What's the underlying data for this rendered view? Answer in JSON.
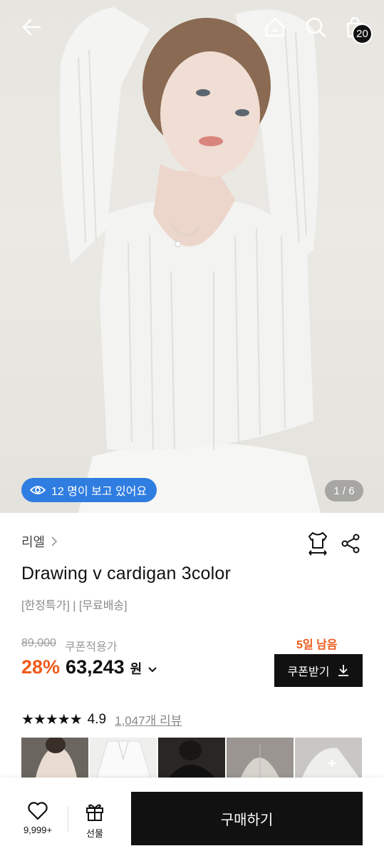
{
  "header": {
    "cart_count": "20",
    "icons": [
      "back-arrow-icon",
      "home-icon",
      "search-icon",
      "shopping-bag-icon"
    ]
  },
  "hero": {
    "viewers_text": "12 명이 보고 있어요",
    "pager": "1 / 6"
  },
  "product": {
    "brand": "리엘",
    "title": "Drawing v cardigan 3color",
    "tags": "[한정특가] | [무료배송]",
    "original_price": "89,000",
    "coupon_price_label": "쿠폰적용가",
    "discount": "28%",
    "price": "63,243",
    "currency": "원",
    "days_left": "5일 남음",
    "coupon_button": "쿠폰받기",
    "rating": "4.9",
    "stars": "★★★★★",
    "reviews": "1,047개 리뷰"
  },
  "bottom_bar": {
    "like_count": "9,999+",
    "gift_label": "선물",
    "buy_label": "구매하기"
  },
  "colors": {
    "accent_orange": "#ee5a1b",
    "viewer_badge_blue": "#2f7de1",
    "button_black": "#111111"
  }
}
